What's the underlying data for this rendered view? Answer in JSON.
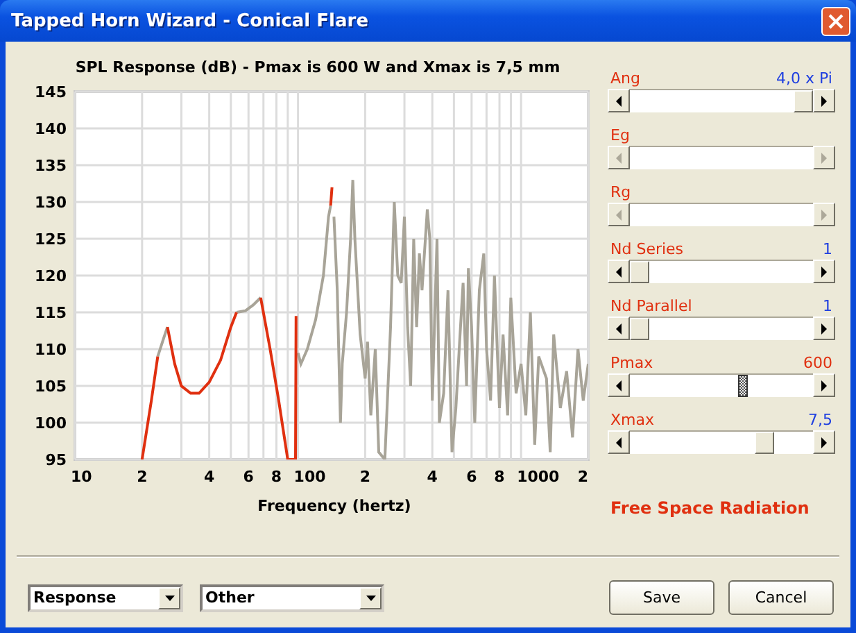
{
  "window": {
    "title": "Tapped Horn Wizard - Conical Flare"
  },
  "chart": {
    "title": "SPL Response (dB) - Pmax is 600 W and Xmax is 7,5 mm",
    "xlabel": "Frequency (hertz)",
    "y_tick_labels": [
      "145",
      "140",
      "135",
      "130",
      "125",
      "120",
      "115",
      "110",
      "105",
      "100",
      "95"
    ],
    "x_tick_labels": [
      "10",
      "2",
      "4",
      "6",
      "8",
      "100",
      "2",
      "4",
      "6",
      "8",
      "1000",
      "2"
    ]
  },
  "sliders": [
    {
      "label": "Ang",
      "value": "4,0 x Pi",
      "color": "#2040e0",
      "disabled": false,
      "focused": false,
      "level": 1.0
    },
    {
      "label": "Eg",
      "disabled": true
    },
    {
      "label": "Rg",
      "disabled": true
    },
    {
      "label": "Nd Series",
      "value": "1",
      "color": "#2040e0",
      "disabled": false,
      "focused": false,
      "level": 0
    },
    {
      "label": "Nd Parallel",
      "value": "1",
      "color": "#2040e0",
      "disabled": false,
      "focused": false,
      "level": 0
    },
    {
      "label": "Pmax",
      "value": "600",
      "color": "#e03010",
      "disabled": false,
      "focused": true,
      "level": 0.62
    },
    {
      "label": "Xmax",
      "value": "7,5",
      "color": "#2040e0",
      "disabled": false,
      "focused": false,
      "level": 0.76
    }
  ],
  "radiation_label": "Free Space Radiation",
  "dropdowns": [
    {
      "value": "Response"
    },
    {
      "value": "Other"
    }
  ],
  "buttons": [
    "Save",
    "Cancel"
  ]
}
